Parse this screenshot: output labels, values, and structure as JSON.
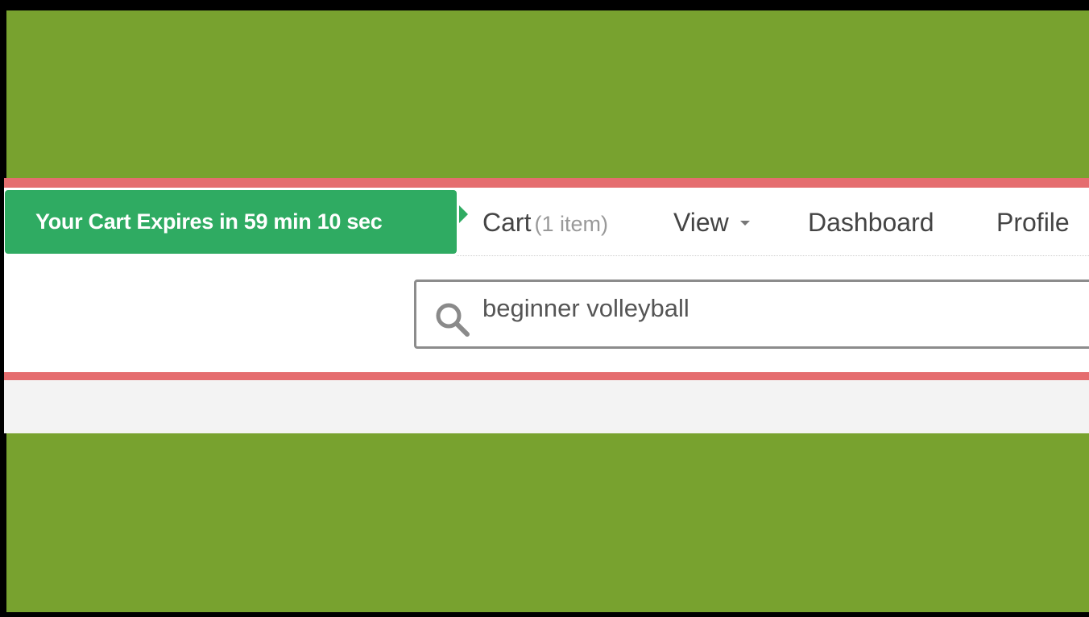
{
  "cart_timer": {
    "text": "Your Cart Expires in 59 min 10 sec"
  },
  "nav": {
    "cart_label": "Cart",
    "cart_count": "(1 item)",
    "view_label": "View",
    "dashboard_label": "Dashboard",
    "profile_label": "Profile"
  },
  "search": {
    "value": "beginner volleyball",
    "icon": "search-icon"
  },
  "colors": {
    "page_background": "#78a22f",
    "accent": "#e56d6f",
    "timer_green": "#2fab62"
  }
}
